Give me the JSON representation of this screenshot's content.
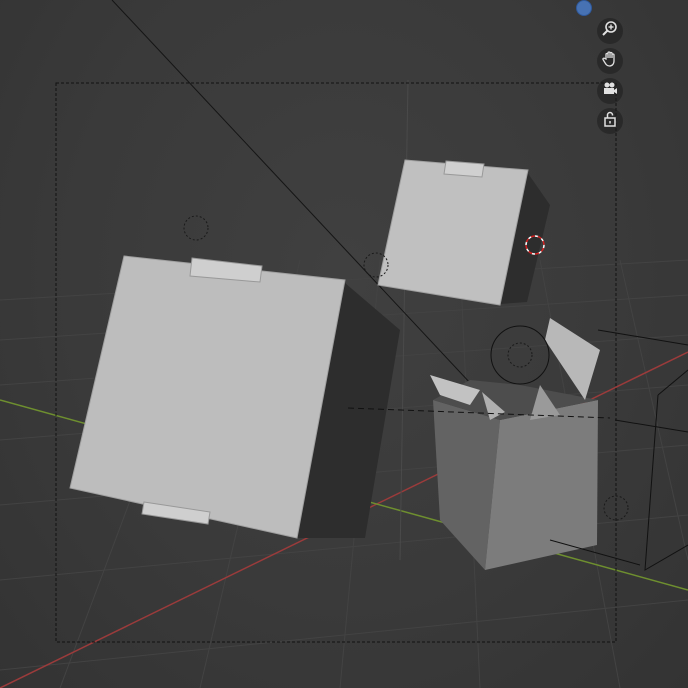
{
  "viewport": {
    "background": "#393939",
    "grid_color": "#444444",
    "x_axis_color": "#9b3b3b",
    "y_axis_color": "#6e8f2f",
    "object_color": "#bdbdbd"
  },
  "navigation": {
    "gizmo_color": "#4772b3",
    "tools": [
      {
        "name": "zoom-icon"
      },
      {
        "name": "pan-hand-icon"
      },
      {
        "name": "camera-view-icon"
      },
      {
        "name": "lock-camera-icon"
      }
    ]
  }
}
